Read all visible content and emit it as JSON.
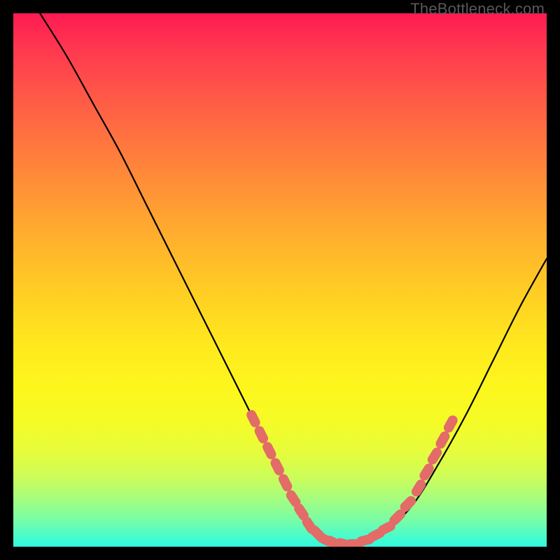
{
  "watermark": "TheBottleneck.com",
  "chart_data": {
    "type": "line",
    "title": "",
    "xlabel": "",
    "ylabel": "",
    "xlim": [
      0,
      100
    ],
    "ylim": [
      0,
      100
    ],
    "series": [
      {
        "name": "bottleneck-curve",
        "x": [
          5,
          10,
          15,
          20,
          25,
          30,
          35,
          40,
          45,
          50,
          52,
          54,
          56,
          58,
          60,
          62,
          64,
          66,
          70,
          75,
          80,
          85,
          90,
          95,
          100
        ],
        "y": [
          100,
          92,
          83,
          74,
          64,
          54,
          44,
          34,
          24,
          14,
          10,
          7,
          4,
          2,
          1,
          0.5,
          0.5,
          1,
          3,
          8,
          16,
          25,
          35,
          45,
          54
        ]
      }
    ],
    "markers": {
      "name": "highlight-dots",
      "color": "#e36b68",
      "points": [
        {
          "x": 45.0,
          "y": 24.0
        },
        {
          "x": 46.5,
          "y": 21.0
        },
        {
          "x": 48.0,
          "y": 18.0
        },
        {
          "x": 49.5,
          "y": 15.0
        },
        {
          "x": 51.0,
          "y": 12.0
        },
        {
          "x": 52.5,
          "y": 9.0
        },
        {
          "x": 54.0,
          "y": 6.5
        },
        {
          "x": 55.5,
          "y": 4.0
        },
        {
          "x": 57.0,
          "y": 2.5
        },
        {
          "x": 58.5,
          "y": 1.3
        },
        {
          "x": 60.0,
          "y": 0.8
        },
        {
          "x": 62.0,
          "y": 0.5
        },
        {
          "x": 64.0,
          "y": 0.5
        },
        {
          "x": 66.0,
          "y": 1.2
        },
        {
          "x": 68.0,
          "y": 2.2
        },
        {
          "x": 70.0,
          "y": 3.5
        },
        {
          "x": 72.0,
          "y": 5.5
        },
        {
          "x": 74.0,
          "y": 8.0
        },
        {
          "x": 76.0,
          "y": 11.0
        },
        {
          "x": 77.5,
          "y": 14.0
        },
        {
          "x": 79.0,
          "y": 17.0
        },
        {
          "x": 80.5,
          "y": 20.0
        },
        {
          "x": 82.0,
          "y": 23.0
        }
      ]
    },
    "gradient_note": "vertical gradient red (top) through orange/yellow to green/teal (bottom)"
  }
}
